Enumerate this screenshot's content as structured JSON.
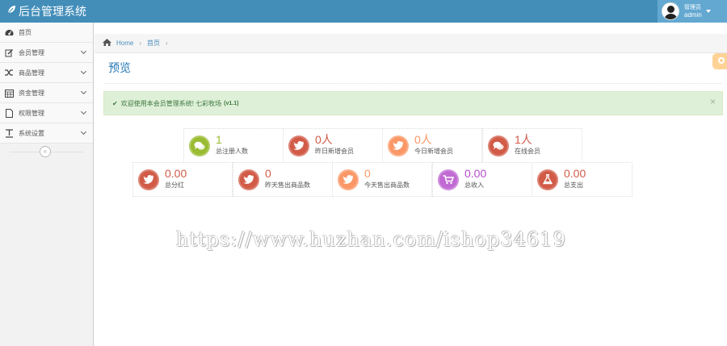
{
  "navbar": {
    "brand": "后台管理系统",
    "user_role": "管理员",
    "user_name": "admin"
  },
  "sidebar": {
    "items": [
      {
        "label": "首页",
        "icon": "dashboard-icon"
      },
      {
        "label": "会员管理",
        "icon": "edit-icon"
      },
      {
        "label": "商品管理",
        "icon": "random-icon"
      },
      {
        "label": "资金管理",
        "icon": "calendar-icon"
      },
      {
        "label": "权限管理",
        "icon": "file-icon"
      },
      {
        "label": "系统设置",
        "icon": "text-width-icon"
      }
    ],
    "collapse_glyph": "«"
  },
  "breadcrumb": {
    "home": "Home",
    "current": "首页"
  },
  "page": {
    "title": "预览"
  },
  "alert": {
    "message": "欢迎使用本会员管理系统! 七彩牧场",
    "version": "(v1.1)",
    "close": "×"
  },
  "stats": [
    {
      "value": "1",
      "label": "总注册人数",
      "icon": "comments-icon",
      "color": "#9abc32",
      "num_color": "#9abc32"
    },
    {
      "value": "0人",
      "label": "昨日新增会员",
      "icon": "twitter-icon",
      "color": "#d15b47",
      "num_color": "#d15b47"
    },
    {
      "value": "0人",
      "label": "今日新增会员",
      "icon": "twitter-icon",
      "color": "#fb9766",
      "num_color": "#fb9766"
    },
    {
      "value": "1人",
      "label": "在线会员",
      "icon": "comments-icon",
      "color": "#d15b47",
      "num_color": "#d15b47"
    },
    {
      "value": "0.00",
      "label": "总分红",
      "icon": "twitter-icon",
      "color": "#d15b47",
      "num_color": "#d15b47"
    },
    {
      "value": "0",
      "label": "昨天售出商品数",
      "icon": "twitter-icon",
      "color": "#d15b47",
      "num_color": "#d15b47"
    },
    {
      "value": "0",
      "label": "今天售出商品数",
      "icon": "twitter-icon",
      "color": "#fb9766",
      "num_color": "#fb9766"
    },
    {
      "value": "0.00",
      "label": "总收入",
      "icon": "shopping-cart-icon",
      "color": "#c16ad3",
      "num_color": "#b34ec7"
    },
    {
      "value": "0.00",
      "label": "总支出",
      "icon": "flask-icon",
      "color": "#d15b47",
      "num_color": "#d15b47"
    }
  ],
  "watermark": "https://www.huzhan.com/ishop34619"
}
